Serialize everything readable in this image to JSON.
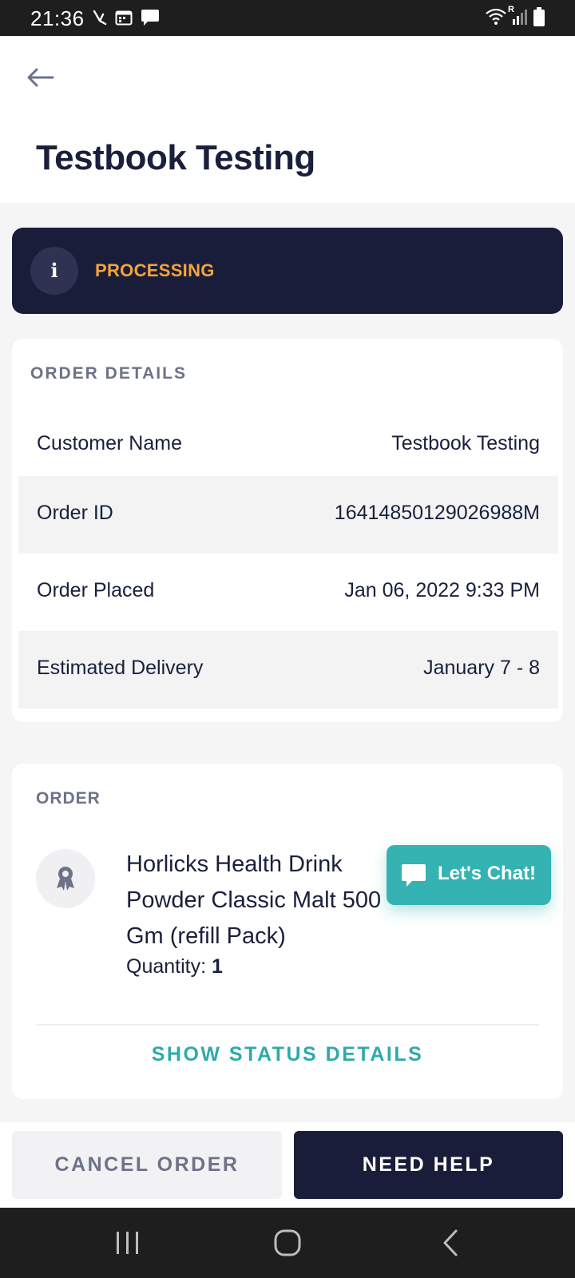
{
  "status_bar": {
    "time": "21:36",
    "icons": [
      "missed-call-icon",
      "calendar-icon",
      "message-icon",
      "wifi-icon",
      "signal-icon",
      "battery-icon"
    ],
    "roaming_label": "R"
  },
  "header": {
    "back_icon": "arrow-left-icon",
    "title": "Testbook Testing"
  },
  "status_banner": {
    "icon": "info-icon",
    "icon_glyph": "i",
    "status": "PROCESSING",
    "status_color": "#f2a53a",
    "background": "#1a1d3a"
  },
  "order_details": {
    "section_title": "ORDER DETAILS",
    "rows": [
      {
        "label": "Customer Name",
        "value": "Testbook Testing"
      },
      {
        "label": "Order ID",
        "value": "16414850129026988M"
      },
      {
        "label": "Order Placed",
        "value": "Jan 06, 2022 9:33 PM"
      },
      {
        "label": "Estimated Delivery",
        "value": "January 7 - 8"
      }
    ]
  },
  "order": {
    "section_title": "ORDER",
    "product_icon": "award-badge-icon",
    "product_name": "Horlicks Health Drink Powder Classic Malt 500 Gm (refill Pack)",
    "quantity_label": "Quantity:",
    "quantity_value": "1",
    "show_status_label": "SHOW STATUS DETAILS",
    "accent": "#2eaaa8"
  },
  "chat": {
    "icon": "chat-bubble-icon",
    "label": "Let's Chat!",
    "color": "#35b3b2"
  },
  "actions": {
    "cancel_label": "CANCEL ORDER",
    "help_label": "NEED HELP"
  },
  "nav_bar": {
    "items": [
      "recent-apps-icon",
      "home-icon",
      "back-icon"
    ]
  }
}
